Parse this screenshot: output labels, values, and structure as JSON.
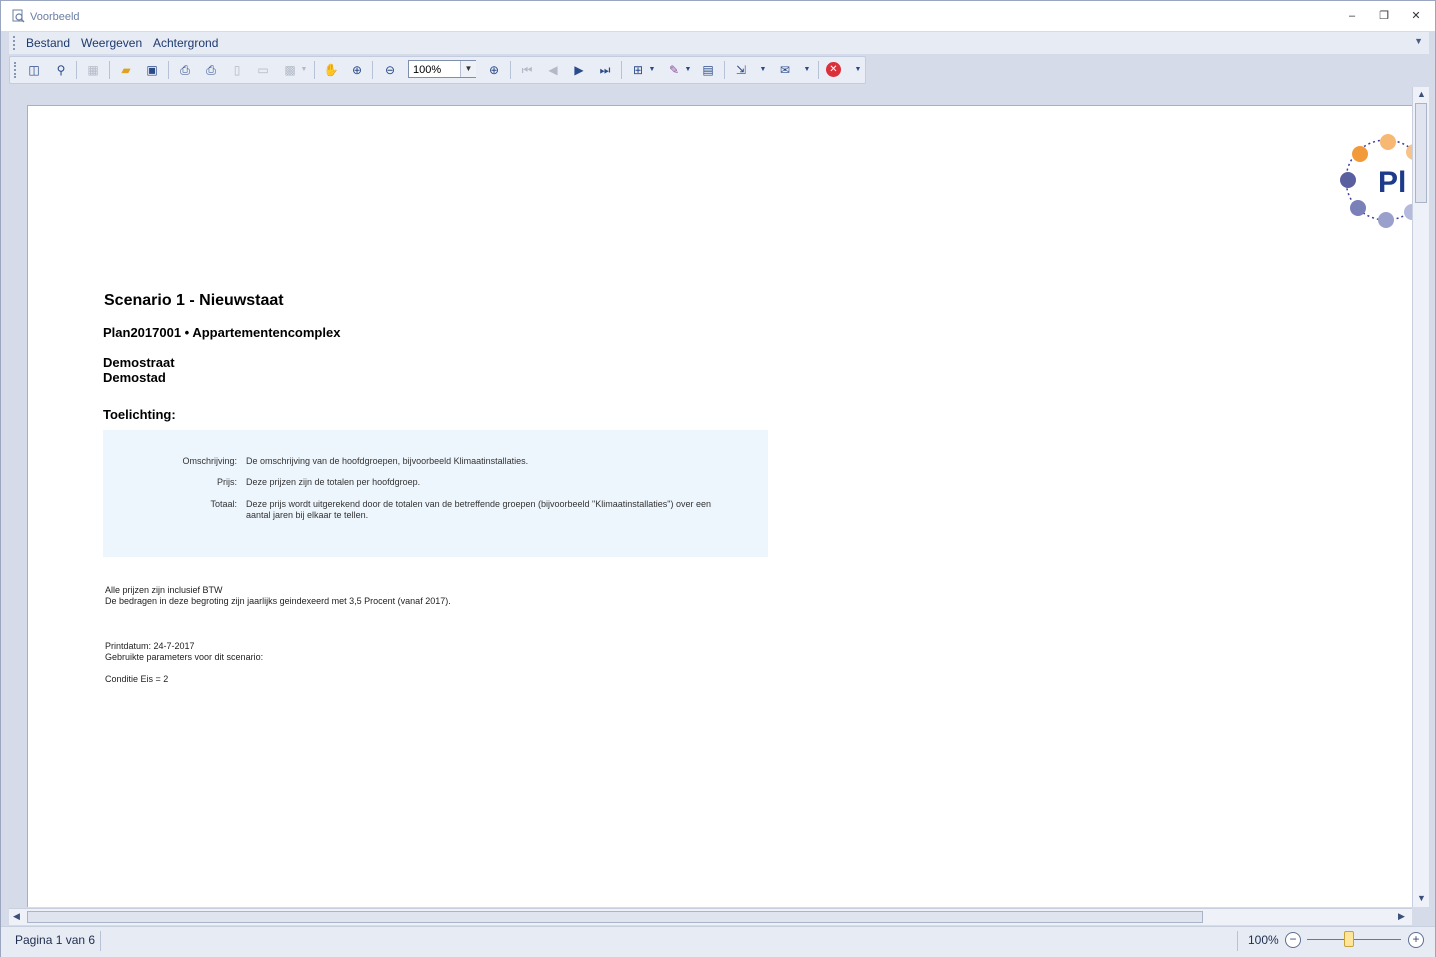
{
  "window": {
    "title": "Voorbeeld",
    "controls": {
      "minimize": "–",
      "restore": "❐",
      "close": "✕"
    }
  },
  "menu": {
    "items": [
      "Bestand",
      "Weergeven",
      "Achtergrond"
    ]
  },
  "toolbar": {
    "zoom_value": "100%"
  },
  "document": {
    "title": "Scenario 1 - Nieuwstaat",
    "project": "Plan2017001 • Appartementencomplex",
    "street": "Demostraat",
    "city": "Demostad",
    "explanation_heading": "Toelichting:",
    "logo_text": "Pl",
    "explanation": [
      {
        "label": "Omschrijving:",
        "value": "De omschrijving van de hoofdgroepen,  bijvoorbeeld  Klimaatinstallaties."
      },
      {
        "label": "Prijs:",
        "value": "Deze  prijzen  zijn  de totalen per hoofdgroep."
      },
      {
        "label": "Totaal:",
        "value": "Deze prijs wordt uitgerekend door de totalen van de betreffende groepen (bijvoorbeeld \"Klimaatinstallaties\") over een aantal jaren bij elkaar te tellen."
      }
    ],
    "note_1": "Alle prijzen zijn inclusief BTW",
    "note_2": "De bedragen in deze begroting zijn jaarlijks geindexeerd met 3,5 Procent (vanaf 2017).",
    "print_date": "Printdatum: 24-7-2017",
    "params_label": "Gebruikte parameters voor dit scenario:",
    "condition": "Conditie Eis = 2"
  },
  "status": {
    "page_info": "Pagina 1 van 6",
    "zoom": "100%",
    "zoom_fraction": 0.45
  }
}
